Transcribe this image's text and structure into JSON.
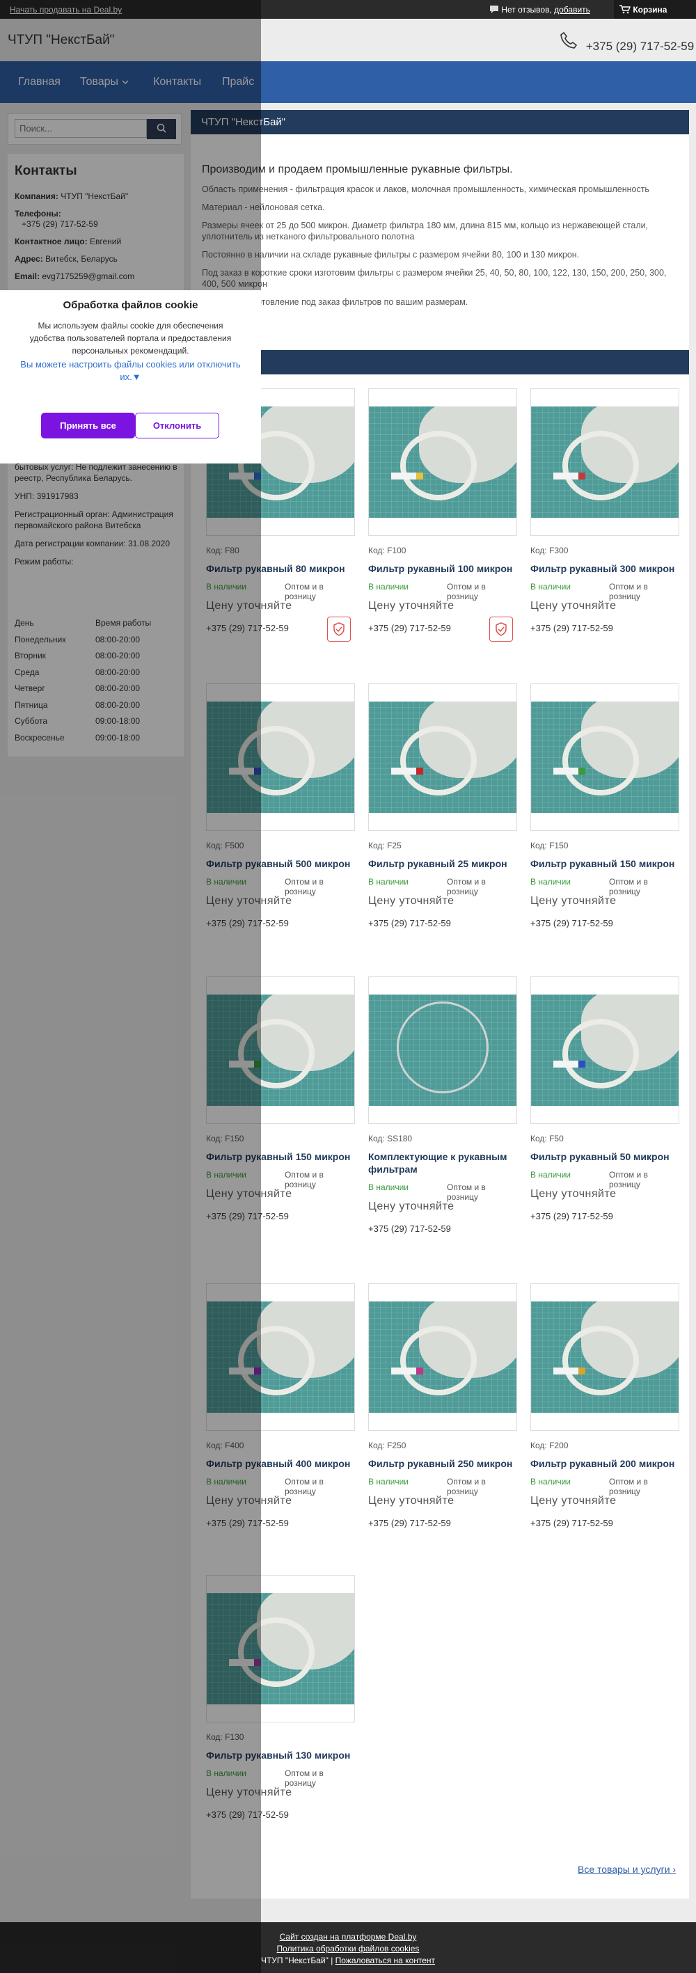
{
  "topbar": {
    "sell_link": "Начать продавать на Deal.by",
    "reviews_text": "Нет отзывов,",
    "reviews_add": "добавить",
    "cart": "Корзина"
  },
  "header": {
    "logo": "ЧТУП \"НекстБай\"",
    "phone": "+375 (29) 717-52-59"
  },
  "nav": {
    "items": [
      "Главная",
      "Товары",
      "Контакты",
      "Прайс"
    ]
  },
  "search": {
    "placeholder": "Поиск..."
  },
  "contacts": {
    "title": "Контакты",
    "company_label": "Компания:",
    "company": "ЧТУП \"НекстБай\"",
    "phones_label": "Телефоны:",
    "phone": "+375 (29) 717-52-59",
    "person_label": "Контактное лицо:",
    "person": "Евгений",
    "address_label": "Адрес:",
    "address": "Витебск, Беларусь",
    "email_label": "Email:",
    "email": "evg7175259@gmail.com",
    "registry": "бытовых услуг: Не подлежит занесению в реестр, Республика Беларусь.",
    "unp": "УНП: 391917983",
    "reg_body": "Регистрационный орган: Администрация первомайского района Витебска",
    "reg_date": "Дата регистрации компании: 31.08.2020",
    "hours_title": "Режим работы:",
    "hours_head": [
      "День",
      "Время работы"
    ],
    "hours": [
      [
        "Понедельник",
        "08:00-20:00"
      ],
      [
        "Вторник",
        "08:00-20:00"
      ],
      [
        "Среда",
        "08:00-20:00"
      ],
      [
        "Четверг",
        "08:00-20:00"
      ],
      [
        "Пятница",
        "08:00-20:00"
      ],
      [
        "Суббота",
        "09:00-18:00"
      ],
      [
        "Воскресенье",
        "09:00-18:00"
      ]
    ]
  },
  "main": {
    "title": "ЧТУП \"НекстБай\"",
    "lead": "Производим и продаем промышленные рукавные фильтры.",
    "paragraphs": [
      "Область применения - фильтрация красок и лаков, молочная промышленность, химическая промышленность",
      "Материал - нейлоновая сетка.",
      "Размеры ячеек от 25 до 500 микрон. Диаметр фильтра 180 мм, длина 815 мм, кольцо из нержавеющей стали, уплотнитель из нетканого фильтровального полотна",
      "Постоянно в наличии на складе рукавные фильтры с размером ячейки 80, 100 и 130 микрон.",
      "Под заказ в короткие сроки изготовим фильтры с размером ячейки  25, 40, 50, 80, 100, 122,  130, 150, 200, 250, 300, 400, 500 микрон",
      "Возможно изготовление под заказ фильтров по вашим размерам."
    ]
  },
  "products": [
    {
      "code": "Код: F80",
      "name": "Фильтр рукавный 80 микрон",
      "tag_color": "#2f6fd1",
      "shield": true
    },
    {
      "code": "Код: F100",
      "name": "Фильтр рукавный 100 микрон",
      "tag_color": "#e8c23a",
      "shield": true
    },
    {
      "code": "Код: F300",
      "name": "Фильтр рукавный 300 микрон",
      "tag_color": "#c23a3a",
      "shield": false
    },
    {
      "code": "Код: F500",
      "name": "Фильтр рукавный 500 микрон",
      "tag_color": "#2f4fc2",
      "shield": false
    },
    {
      "code": "Код: F25",
      "name": "Фильтр рукавный 25 микрон",
      "tag_color": "#c22a2a",
      "shield": false
    },
    {
      "code": "Код: F150",
      "name": "Фильтр рукавный 150 микрон",
      "tag_color": "#3a9a3a",
      "shield": false
    },
    {
      "code": "Код: F150",
      "name": "Фильтр рукавный 150 микрон",
      "tag_color": "#3a9a3a",
      "shield": false
    },
    {
      "code": "Код: SS180",
      "name": "Комплектующие к рукавным фильтрам",
      "tag_color": "",
      "shield": false
    },
    {
      "code": "Код: F50",
      "name": "Фильтр рукавный 50 микрон",
      "tag_color": "#2a4fc2",
      "shield": false
    },
    {
      "code": "Код: F400",
      "name": "Фильтр рукавный 400 микрон",
      "tag_color": "#9a2ac2",
      "shield": false
    },
    {
      "code": "Код: F250",
      "name": "Фильтр рукавный 250 микрон",
      "tag_color": "#c2368a",
      "shield": false
    },
    {
      "code": "Код: F200",
      "name": "Фильтр рукавный 200 микрон",
      "tag_color": "#d6a52a",
      "shield": false
    },
    {
      "code": "Код: F130",
      "name": "Фильтр рукавный 130 микрон",
      "tag_color": "#a23aa2",
      "shield": false
    }
  ],
  "product_common": {
    "avail": "В наличии",
    "sale": "Оптом и в розницу",
    "price": "Цену уточняйте",
    "phone": "+375 (29) 717-52-59"
  },
  "all_goods": "Все товары и услуги",
  "footer": {
    "line1": "Сайт создан на платформе Deal.by",
    "line2": "Политика обработки файлов cookies",
    "line3_prefix": "ЧТУП \"НекстБай\" | ",
    "line3_link": "Пожаловаться на контент"
  },
  "cookie": {
    "title": "Обработка файлов cookie",
    "text": "Мы используем файлы cookie для обеспечения удобства пользователей портала и предоставления персональных рекомендаций.",
    "link": "Вы можете настроить файлы cookies или отключить их.▼",
    "accept": "Принять все",
    "decline": "Отклонить"
  }
}
